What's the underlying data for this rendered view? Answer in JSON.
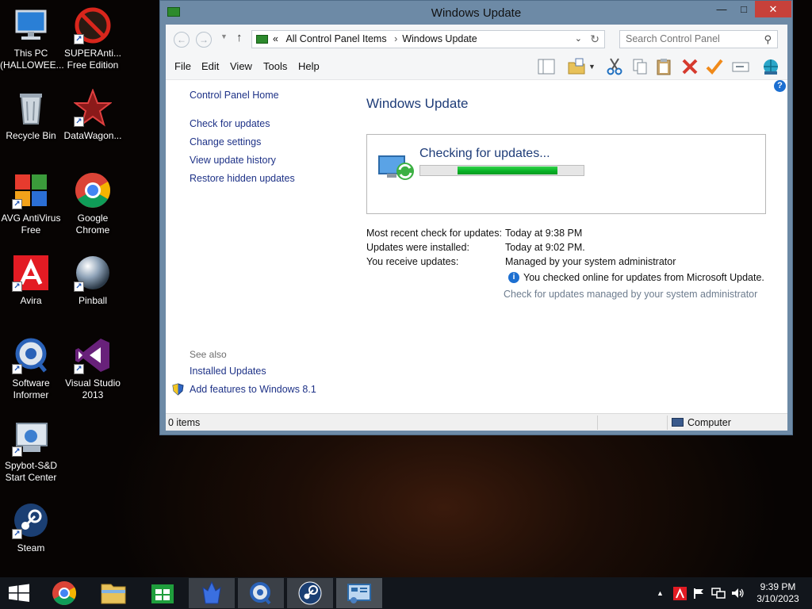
{
  "desktop": {
    "icons": [
      {
        "label": "This PC (HALLOWEE...",
        "icon": "computer-icon"
      },
      {
        "label": "SUPERAnti... Free Edition",
        "icon": "superantispyware-icon"
      },
      {
        "label": "Recycle Bin",
        "icon": "recycle-bin-icon"
      },
      {
        "label": "DataWagon...",
        "icon": "datawagon-icon"
      },
      {
        "label": "AVG AntiVirus Free",
        "icon": "avg-icon"
      },
      {
        "label": "Google Chrome",
        "icon": "chrome-icon"
      },
      {
        "label": "Avira",
        "icon": "avira-icon"
      },
      {
        "label": "Pinball",
        "icon": "pinball-icon"
      },
      {
        "label": "Software Informer",
        "icon": "software-informer-icon"
      },
      {
        "label": "Visual Studio 2013",
        "icon": "visual-studio-icon"
      },
      {
        "label": "Spybot-S&D Start Center",
        "icon": "spybot-icon"
      },
      {
        "label": "Steam",
        "icon": "steam-icon"
      }
    ]
  },
  "window": {
    "title": "Windows Update",
    "controls": {
      "minimize": "—",
      "maximize": "□",
      "close": "✕"
    },
    "address": {
      "crumb_prefix": "«",
      "crumbs": [
        "All Control Panel Items",
        "Windows Update"
      ],
      "separator": "›"
    },
    "search": {
      "placeholder": "Search Control Panel"
    },
    "menu": [
      "File",
      "Edit",
      "View",
      "Tools",
      "Help"
    ],
    "left_nav": {
      "home": "Control Panel Home",
      "links": [
        "Check for updates",
        "Change settings",
        "View update history",
        "Restore hidden updates"
      ],
      "see_also_title": "See also",
      "see_also": [
        "Installed Updates",
        "Add features to Windows 8.1"
      ]
    },
    "main": {
      "heading": "Windows Update",
      "status": "Checking for updates...",
      "progress": {
        "start": 0.23,
        "end": 0.84
      },
      "info": [
        {
          "label": "Most recent check for updates:",
          "value": "Today at 9:38 PM"
        },
        {
          "label": "Updates were installed:",
          "value": "Today at 9:02 PM."
        },
        {
          "label": "You receive updates:",
          "value": "Managed by your system administrator"
        }
      ],
      "note": "You checked online for updates from Microsoft Update.",
      "managed_link": "Check for updates managed by your system administrator"
    },
    "statusbar": {
      "items": "0 items",
      "location": "Computer"
    }
  },
  "taskbar": {
    "apps": [
      "start-icon",
      "chrome-icon",
      "file-explorer-icon",
      "store-icon",
      "crystal-app-icon",
      "software-informer-icon",
      "steam-icon",
      "control-panel-icon"
    ],
    "clock": {
      "time": "9:39 PM",
      "date": "3/10/2023"
    }
  },
  "colors": {
    "accent": "#1e3c78",
    "link": "#1e3287",
    "progress": "#06b025",
    "close": "#c7413a"
  }
}
